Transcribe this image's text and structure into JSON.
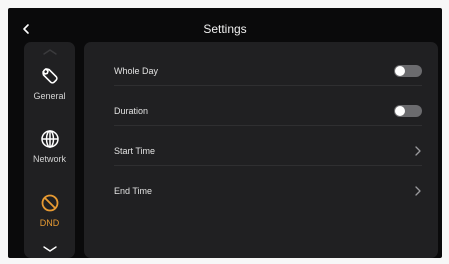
{
  "header": {
    "title": "Settings",
    "back_icon": "chevron-left-icon"
  },
  "sidebar": {
    "items": [
      {
        "label": "General",
        "icon": "wrench-icon",
        "active": false
      },
      {
        "label": "Network",
        "icon": "globe-icon",
        "active": false
      },
      {
        "label": "DND",
        "icon": "do-not-disturb-icon",
        "active": true
      }
    ],
    "scroll_up_icon": "chevron-up-icon",
    "scroll_down_icon": "chevron-down-icon"
  },
  "settings": {
    "rows": [
      {
        "label": "Whole Day",
        "control": "toggle",
        "on": false
      },
      {
        "label": "Duration",
        "control": "toggle",
        "on": false
      },
      {
        "label": "Start Time",
        "control": "chevron",
        "icon": "chevron-right-icon"
      },
      {
        "label": "End Time",
        "control": "chevron",
        "icon": "chevron-right-icon"
      }
    ]
  },
  "colors": {
    "background": "#0a0a0b",
    "card": "#202022",
    "accent": "#e79a32",
    "toggle_off_track": "#6b6b6e"
  }
}
